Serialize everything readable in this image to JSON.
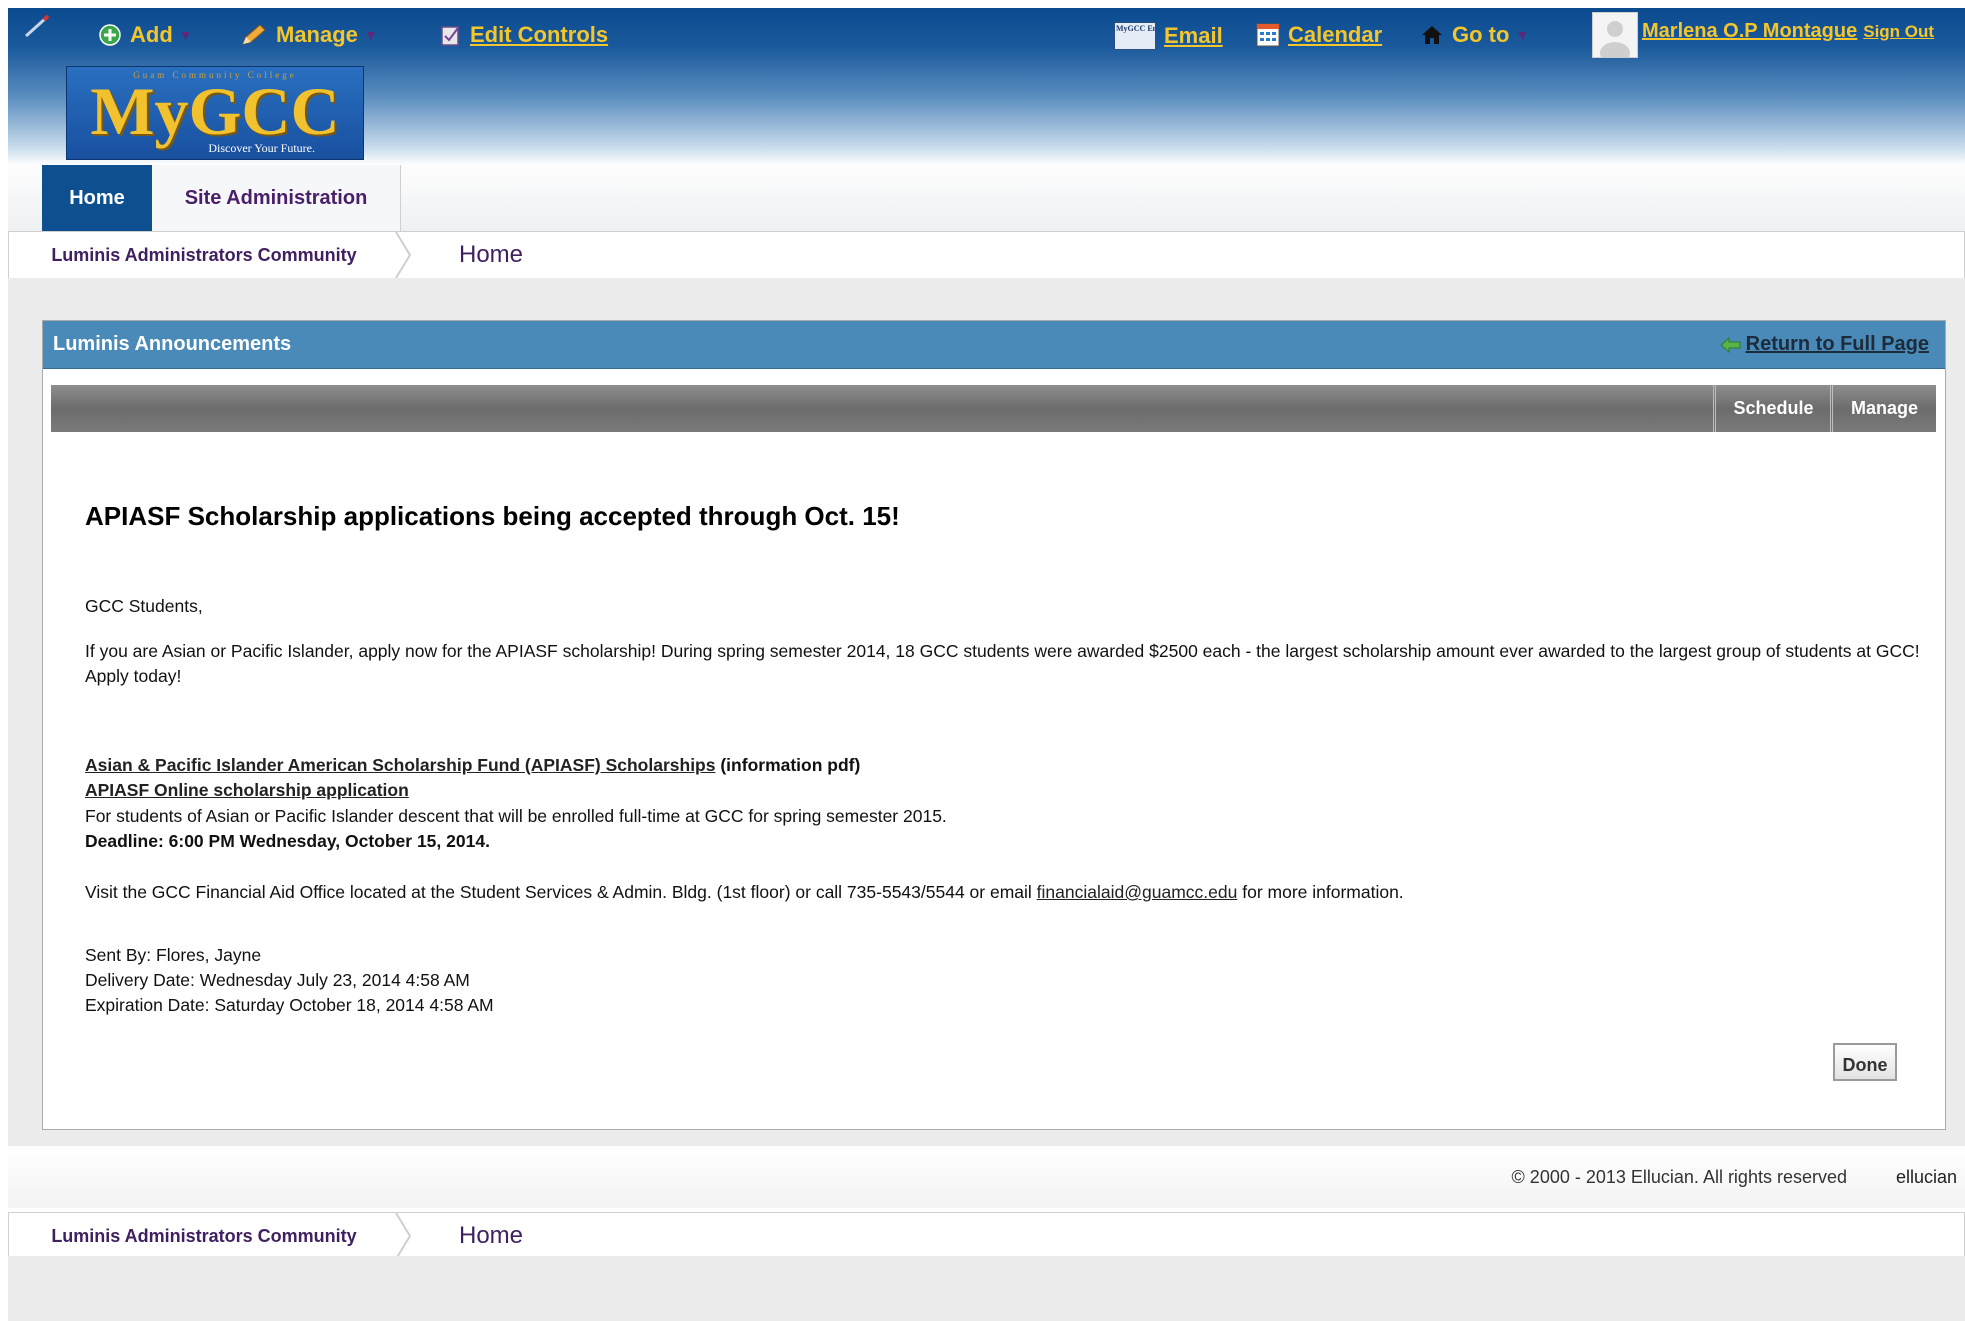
{
  "topnav": {
    "add": "Add",
    "manage": "Manage",
    "edit_controls": "Edit Controls",
    "email_icon_text": "MyGCC Email",
    "email": "Email",
    "calendar": "Calendar",
    "goto": "Go to",
    "user_name": "Marlena O.P Montague",
    "sign_out": "Sign Out"
  },
  "logo": {
    "top_text": "Guam Community College",
    "main": "MyGCC",
    "tagline": "Discover Your Future."
  },
  "tabs": [
    {
      "label": "Home",
      "active": true
    },
    {
      "label": "Site Administration",
      "active": false
    }
  ],
  "breadcrumb": {
    "community": "Luminis Administrators Community",
    "page": "Home"
  },
  "portlet": {
    "title": "Luminis Announcements",
    "return_link": "Return to Full Page",
    "toolbar": {
      "schedule": "Schedule",
      "manage": "Manage"
    },
    "announcement": {
      "title": "APIASF Scholarship applications being accepted through Oct. 15!",
      "greeting": "GCC Students,",
      "body": "If you are Asian or Pacific Islander, apply now for the APIASF scholarship! During spring semester 2014, 18 GCC students were awarded $2500 each - the largest scholarship amount ever awarded to the largest group of students at GCC! Apply today!",
      "link1": "Asian & Pacific Islander American Scholarship Fund (APIASF) Scholarships",
      "link1_suffix": "(information pdf)",
      "link2": "APIASF Online scholarship application",
      "eligibility": "For students of Asian or Pacific Islander descent that will be enrolled full-time at GCC for spring semester 2015.",
      "deadline": "Deadline: 6:00 PM Wednesday, October 15, 2014.",
      "visit_prefix": "Visit the GCC Financial Aid Office located at the Student Services & Admin. Bldg. (1st floor) or call 735-5543/5544 or email",
      "email": "financialaid@guamcc.edu",
      "visit_suffix": "for more information.",
      "sent_by": "Sent By: Flores, Jayne",
      "delivery_date": "Delivery Date: Wednesday July 23, 2014 4:58 AM",
      "expiration_date": "Expiration Date: Saturday October 18, 2014 4:58 AM"
    },
    "done_button": "Done"
  },
  "footer": {
    "copyright": "© 2000 - 2013 Ellucian. All rights reserved",
    "brand": "ellucian"
  },
  "colors": {
    "header_blue": "#0b4a8f",
    "nav_gold": "#f3c62c",
    "portlet_header": "#4a8ab8",
    "crumb_purple": "#3f1f60"
  }
}
